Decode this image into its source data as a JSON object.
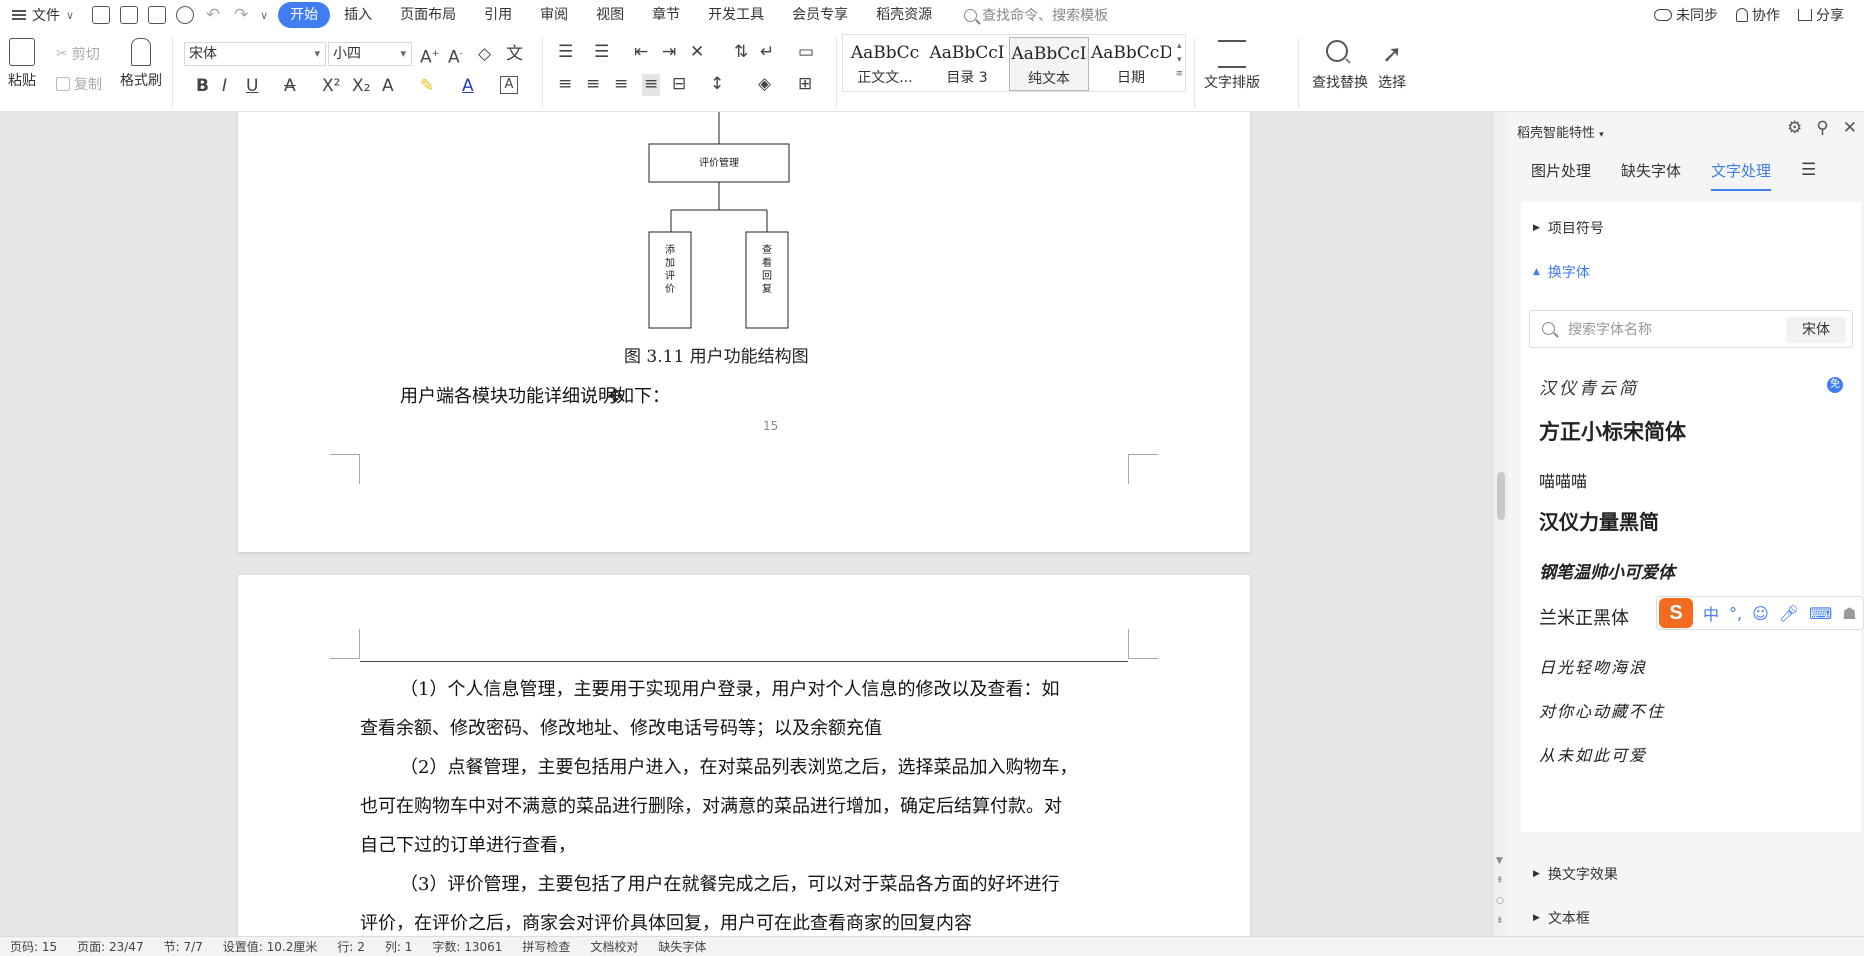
{
  "menubar": {
    "file_label": "文件",
    "tabs": [
      "开始",
      "插入",
      "页面布局",
      "引用",
      "审阅",
      "视图",
      "章节",
      "开发工具",
      "会员专享",
      "稻壳资源"
    ],
    "search_placeholder": "查找命令、搜索模板",
    "sync_label": "未同步",
    "collab_label": "协作",
    "share_label": "分享"
  },
  "ribbon": {
    "paste": "粘贴",
    "cut": "剪切",
    "copy": "复制",
    "format_painter": "格式刷",
    "font_name": "宋体",
    "font_size": "小四",
    "styles": [
      {
        "sample": "AaBbCc",
        "label": "正文文..."
      },
      {
        "sample": "AaBbCcI",
        "label": "目录 3"
      },
      {
        "sample": "AaBbCcI",
        "label": "纯文本"
      },
      {
        "sample": "AaBbCcD",
        "label": "日期"
      }
    ],
    "text_layout": "文字排版",
    "find_replace": "查找替换",
    "select": "选择"
  },
  "document": {
    "diagram_root": "评价管理",
    "diagram_children": [
      "添加评价",
      "查看回复"
    ],
    "figure_caption": "图 3.11  用户功能结构图",
    "intro_line": "用户端各模块功能详细说明如下：",
    "page_number": "15",
    "paragraphs": [
      "（1）个人信息管理，主要用于实现用户登录，用户对个人信息的修改以及查看：如",
      "查看余额、修改密码、修改地址、修改电话号码等；以及余额充值",
      "（2）点餐管理，主要包括用户进入，在对菜品列表浏览之后，选择菜品加入购物车，",
      "也可在购物车中对不满意的菜品进行删除，对满意的菜品进行增加，确定后结算付款。对",
      "自己下过的订单进行查看，",
      "（3）评价管理，主要包括了用户在就餐完成之后，可以对于菜品各方面的好坏进行",
      "评价，在评价之后，商家会对评价具体回复，用户可在此查看商家的回复内容"
    ]
  },
  "panel": {
    "title": "稻壳智能特性",
    "tabs": [
      "图片处理",
      "缺失字体",
      "文字处理"
    ],
    "section_bullets": "项目符号",
    "section_fonts": "换字体",
    "font_search_placeholder": "搜索字体名称",
    "current_font": "宋体",
    "fonts": [
      "汉仪青云简",
      "方正小标宋简体",
      "喵喵喵",
      "汉仪力量黑简",
      "钢笔温帅小可爱体",
      "兰米正黑体",
      "日光轻吻海浪",
      "对你心动藏不住",
      "从未如此可爱"
    ],
    "free_badge": "免",
    "section_effects": "换文字效果",
    "section_textbox": "文本框"
  },
  "ime": {
    "logo": "S",
    "mode": "中"
  },
  "statusbar": {
    "items": [
      "页码: 15",
      "页面: 23/47",
      "节: 7/7",
      "设置值: 10.2厘米",
      "行: 2",
      "列: 1",
      "字数: 13061",
      "拼写检查",
      "文档校对",
      "缺失字体"
    ]
  }
}
